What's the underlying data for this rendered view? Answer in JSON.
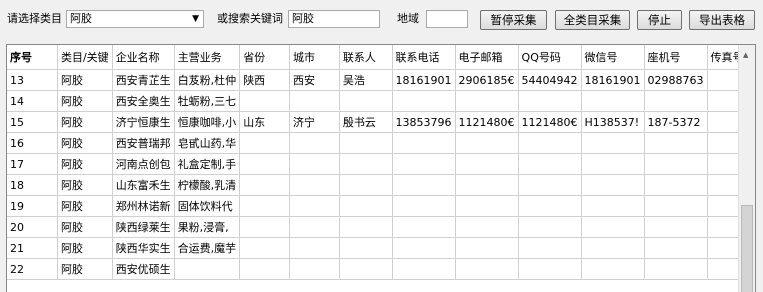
{
  "toolbar": {
    "category_label": "请选择类目",
    "category_value": "阿胶",
    "keyword_label": "或搜索关键词",
    "keyword_value": "阿胶",
    "region_label": "地域",
    "region_value": "",
    "pause_label": "暂停采集",
    "all_label": "全类目采集",
    "stop_label": "停止",
    "export_label": "导出表格"
  },
  "table": {
    "headers": [
      "序号",
      "类目/关键",
      "企业名称",
      "主营业务",
      "省份",
      "城市",
      "联系人",
      "联系电话",
      "电子邮箱",
      "QQ号码",
      "微信号",
      "座机号",
      "传真号"
    ],
    "rows": [
      [
        "13",
        "阿胶",
        "西安青芷生",
        "白芨粉,杜仲",
        "陕西",
        "西安",
        "吴浩",
        "18161901",
        "2906185€",
        "54404942",
        "18161901",
        "02988763",
        ""
      ],
      [
        "14",
        "阿胶",
        "西安全奥生",
        "牡蛎粉,三七",
        "",
        "",
        "",
        "",
        "",
        "",
        "",
        "",
        ""
      ],
      [
        "15",
        "阿胶",
        "济宁恒康生",
        "恒康咖啡,小",
        "山东",
        "济宁",
        "殷书云",
        "13853796",
        "1121480€",
        "1121480€",
        "H138537!",
        "187-5372",
        ""
      ],
      [
        "16",
        "阿胶",
        "西安普瑞邦",
        "皂甙山药,华",
        "",
        "",
        "",
        "",
        "",
        "",
        "",
        "",
        ""
      ],
      [
        "17",
        "阿胶",
        "河南点创包",
        "礼盒定制,手",
        "",
        "",
        "",
        "",
        "",
        "",
        "",
        "",
        ""
      ],
      [
        "18",
        "阿胶",
        "山东富禾生",
        "柠檬酸,乳清",
        "",
        "",
        "",
        "",
        "",
        "",
        "",
        "",
        ""
      ],
      [
        "19",
        "阿胶",
        "郑州林诺新",
        "固体饮料代",
        "",
        "",
        "",
        "",
        "",
        "",
        "",
        "",
        ""
      ],
      [
        "20",
        "阿胶",
        "陕西绿莱生",
        "果粉,浸膏,",
        "",
        "",
        "",
        "",
        "",
        "",
        "",
        "",
        ""
      ],
      [
        "21",
        "阿胶",
        "陕西华实生",
        "合运费,魔芋",
        "",
        "",
        "",
        "",
        "",
        "",
        "",
        "",
        ""
      ],
      [
        "22",
        "阿胶",
        "西安优硕生",
        "",
        "",
        "",
        "",
        "",
        "",
        "",
        "",
        "",
        ""
      ]
    ]
  },
  "icons": {
    "dropdown": "chevron-down-icon",
    "scroll_up": "scroll-up-arrow-icon"
  }
}
